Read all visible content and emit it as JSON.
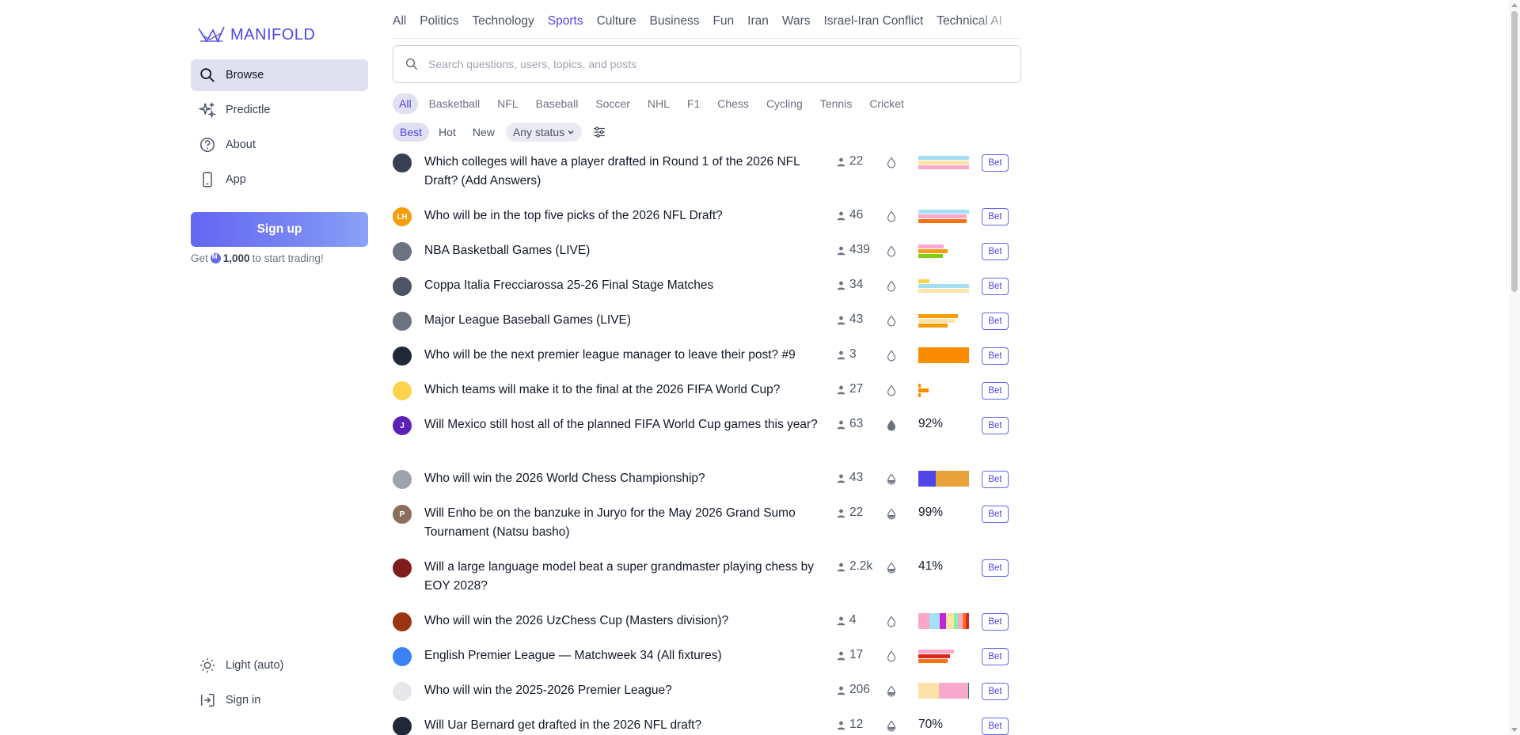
{
  "brand": {
    "name": "MANIFOLD",
    "accent": "#4f46e5"
  },
  "sidebar": {
    "items": [
      {
        "label": "Browse",
        "icon": "search-icon",
        "active": true
      },
      {
        "label": "Predictle",
        "icon": "sparkles-icon"
      },
      {
        "label": "About",
        "icon": "question-circle-icon"
      },
      {
        "label": "App",
        "icon": "phone-icon"
      }
    ],
    "signup_label": "Sign up",
    "signup_note_prefix": "Get",
    "signup_note_amount": "1,000",
    "signup_note_suffix": "to start trading!",
    "bottom": [
      {
        "label": "Light (auto)",
        "icon": "sun-icon"
      },
      {
        "label": "Sign in",
        "icon": "sign-in-icon"
      }
    ]
  },
  "topics": [
    "All",
    "Politics",
    "Technology",
    "Sports",
    "Culture",
    "Business",
    "Fun",
    "Iran",
    "Wars",
    "Israel-Iran Conflict",
    "Technical AI"
  ],
  "active_topic": "Sports",
  "search": {
    "placeholder": "Search questions, users, topics, and posts"
  },
  "subtopics": [
    "All",
    "Basketball",
    "NFL",
    "Baseball",
    "Soccer",
    "NHL",
    "F1",
    "Chess",
    "Cycling",
    "Tennis",
    "Cricket"
  ],
  "sorts": [
    "Best",
    "Hot",
    "New"
  ],
  "status_filter": "Any status",
  "bet_label": "Bet",
  "markets": [
    {
      "title": "Which colleges will have a player drafted in Round 1 of the 2026 NFL Draft? (Add Answers)",
      "traders": "22",
      "avatar_color": "#374151",
      "drop": "empty",
      "bars": [
        {
          "w": 1.0,
          "c": "#a5dff5"
        },
        {
          "w": 1.0,
          "c": "#fde3a7"
        },
        {
          "w": 1.0,
          "c": "#f9a8c9"
        }
      ]
    },
    {
      "title": "Who will be in the top five picks of the 2026 NFL Draft?",
      "traders": "46",
      "avatar_color": "#f59e0b",
      "avatar_text": "LH",
      "drop": "empty",
      "bars": [
        {
          "w": 1.0,
          "c": "#a5dff5"
        },
        {
          "w": 0.95,
          "c": "#f9a8c9"
        },
        {
          "w": 0.95,
          "c": "#f97316"
        }
      ]
    },
    {
      "title": "NBA Basketball Games (LIVE)",
      "traders": "439",
      "avatar_color": "#6b7280",
      "drop": "empty",
      "bars": [
        {
          "w": 0.5,
          "c": "#f9a8d4"
        },
        {
          "w": 0.58,
          "c": "#f59e0b"
        },
        {
          "w": 0.48,
          "c": "#84cc16"
        }
      ]
    },
    {
      "title": "Coppa Italia Frecciarossa 25-26 Final Stage Matches",
      "traders": "34",
      "avatar_color": "#4b5563",
      "drop": "empty",
      "bars": [
        {
          "w": 0.22,
          "c": "#fcd34d"
        },
        {
          "w": 1.0,
          "c": "#a5dff5"
        },
        {
          "w": 1.0,
          "c": "#fde3a7"
        }
      ]
    },
    {
      "title": "Major League Baseball Games (LIVE)",
      "traders": "43",
      "avatar_color": "#6b7280",
      "drop": "empty",
      "bars": [
        {
          "w": 0.78,
          "c": "#f59e0b"
        },
        {
          "w": 0.72,
          "c": "#fde3a7"
        },
        {
          "w": 0.58,
          "c": "#f59e0b"
        }
      ]
    },
    {
      "title": "Who will be the next premier league manager to leave their post? #9",
      "traders": "3",
      "avatar_color": "#1f2937",
      "drop": "empty",
      "bars": [
        {
          "w": 1.0,
          "c": "#fb8c00",
          "tall": true
        }
      ]
    },
    {
      "title": "Which teams will make it to the final at the 2026 FIFA World Cup?",
      "traders": "27",
      "avatar_color": "#fcd34d",
      "drop": "empty",
      "bars": [
        {
          "w": 0.04,
          "c": "#fb8c00"
        },
        {
          "w": 0.2,
          "c": "#fb8c00"
        },
        {
          "w": 0.04,
          "c": "#fb8c00"
        }
      ]
    },
    {
      "title": "Will Mexico still host all of the planned FIFA World Cup games this year?",
      "traders": "63",
      "avatar_color": "#5b21b6",
      "avatar_text": "J",
      "drop": "full",
      "prob": "92%"
    },
    {
      "title": "Who will win the 2026 World Chess Championship?",
      "traders": "43",
      "avatar_color": "#9ca3af",
      "drop": "half",
      "segments": [
        {
          "w": 0.35,
          "c": "#4f46e5"
        },
        {
          "w": 0.65,
          "c": "#e8a23c"
        }
      ]
    },
    {
      "title": "Will Enho be on the banzuke in Juryo for the May 2026 Grand Sumo Tournament (Natsu basho)",
      "traders": "22",
      "avatar_color": "#8b6f5c",
      "avatar_text": "P",
      "drop": "half",
      "prob": "99%"
    },
    {
      "title": "Will a large language model beat a super grandmaster playing chess by EOY 2028?",
      "traders": "2.2k",
      "avatar_color": "#7f1d1d",
      "drop": "half",
      "prob": "41%"
    },
    {
      "title": "Who will win the 2026 UzChess Cup (Masters division)?",
      "traders": "4",
      "avatar_color": "#9a3412",
      "drop": "empty",
      "segments": [
        {
          "w": 0.22,
          "c": "#f9a8c9"
        },
        {
          "w": 0.2,
          "c": "#a5dff5"
        },
        {
          "w": 0.12,
          "c": "#c026d3"
        },
        {
          "w": 0.16,
          "c": "#fde3a7"
        },
        {
          "w": 0.08,
          "c": "#86efac"
        },
        {
          "w": 0.1,
          "c": "#f9a8c9"
        },
        {
          "w": 0.06,
          "c": "#f97316"
        },
        {
          "w": 0.06,
          "c": "#dc2626"
        }
      ]
    },
    {
      "title": "English Premier League — Matchweek 34 (All fixtures)",
      "traders": "17",
      "avatar_color": "#3b82f6",
      "drop": "empty",
      "bars": [
        {
          "w": 0.7,
          "c": "#f9a8c9"
        },
        {
          "w": 0.62,
          "c": "#dc2626"
        },
        {
          "w": 0.58,
          "c": "#f97316"
        }
      ]
    },
    {
      "title": "Who will win the 2025-2026 Premier League?",
      "traders": "206",
      "avatar_color": "#e5e7eb",
      "drop": "half",
      "segments": [
        {
          "w": 0.4,
          "c": "#fde3a7"
        },
        {
          "w": 0.58,
          "c": "#f9a8c9"
        },
        {
          "w": 0.02,
          "c": "#0f766e"
        }
      ]
    },
    {
      "title": "Will Uar Bernard get drafted in the 2026 NFL draft?",
      "traders": "12",
      "avatar_color": "#1f2937",
      "drop": "half",
      "prob": "70%"
    }
  ]
}
